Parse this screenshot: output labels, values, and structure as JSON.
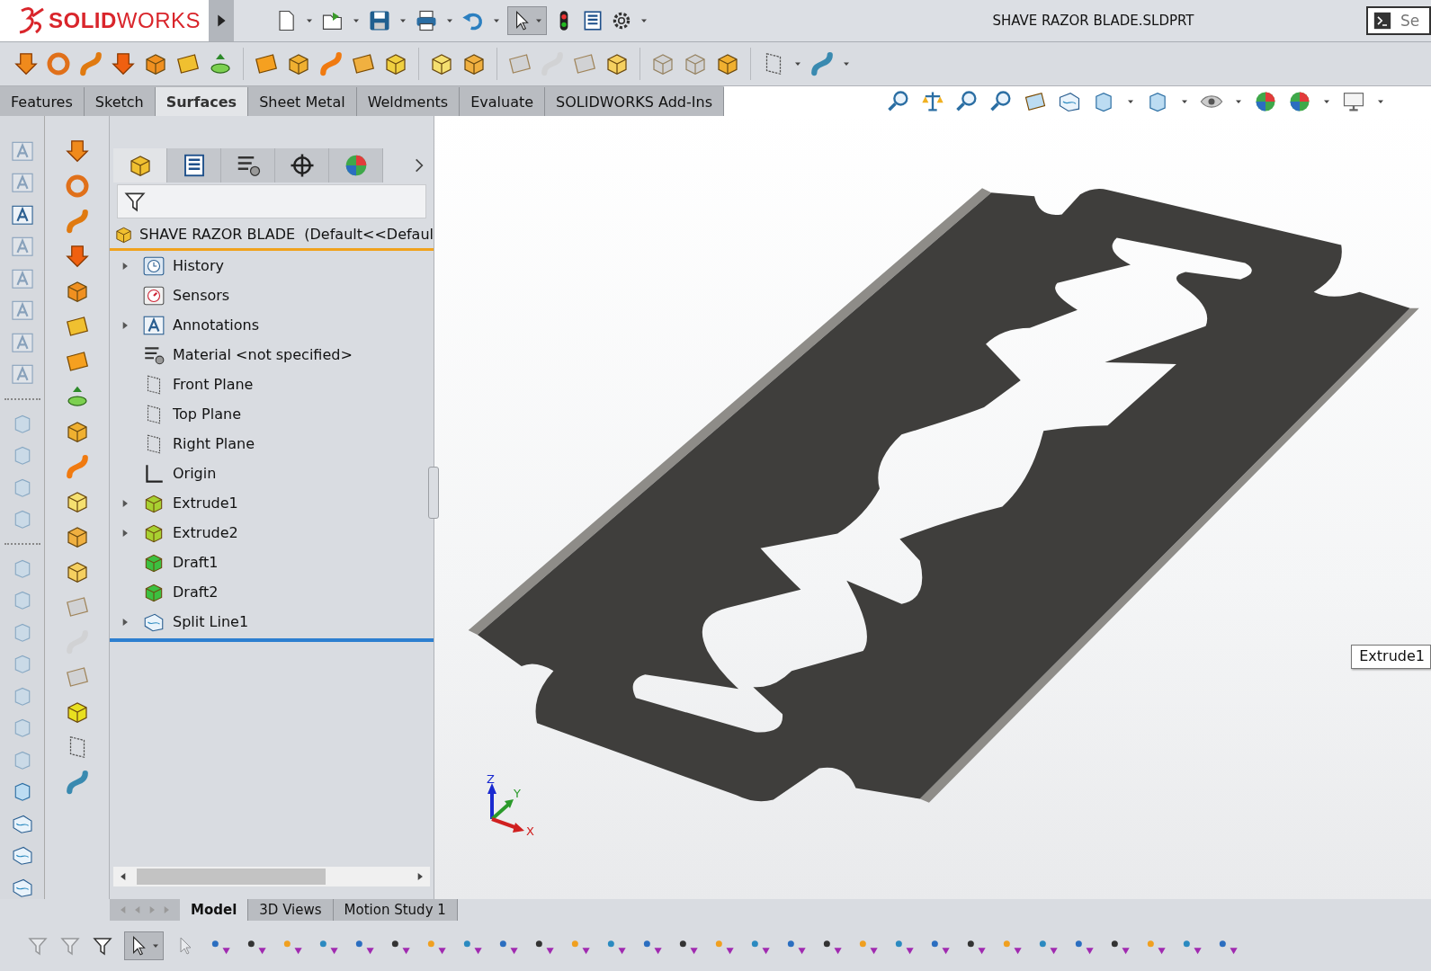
{
  "title_bar": {
    "logo": "**SOLID**WORKS",
    "document_title": "SHAVE RAZOR BLADE.SLDPRT",
    "search": {
      "placeholder": "Se"
    }
  },
  "command_tabs": [
    {
      "label": "Features",
      "selected": false
    },
    {
      "label": "Sketch",
      "selected": false
    },
    {
      "label": "Surfaces",
      "selected": true
    },
    {
      "label": "Sheet Metal",
      "selected": false
    },
    {
      "label": "Weldments",
      "selected": false
    },
    {
      "label": "Evaluate",
      "selected": false
    },
    {
      "label": "SOLIDWORKS Add-Ins",
      "selected": false
    }
  ],
  "feature_tree": {
    "root": {
      "label": "SHAVE RAZOR BLADE  (Default<<Defaul"
    },
    "items": [
      {
        "label": "History",
        "kind": "history",
        "expandable": true
      },
      {
        "label": "Sensors",
        "kind": "sensors",
        "expandable": false
      },
      {
        "label": "Annotations",
        "kind": "annotations",
        "expandable": true
      },
      {
        "label": "Material <not specified>",
        "kind": "material",
        "expandable": false
      },
      {
        "label": "Front Plane",
        "kind": "plane",
        "expandable": false
      },
      {
        "label": "Top Plane",
        "kind": "plane",
        "expandable": false
      },
      {
        "label": "Right Plane",
        "kind": "plane",
        "expandable": false
      },
      {
        "label": "Origin",
        "kind": "origin",
        "expandable": false
      },
      {
        "label": "Extrude1",
        "kind": "extrude",
        "expandable": true
      },
      {
        "label": "Extrude2",
        "kind": "extrude",
        "expandable": true
      },
      {
        "label": "Draft1",
        "kind": "draft",
        "expandable": false
      },
      {
        "label": "Draft2",
        "kind": "draft",
        "expandable": false
      },
      {
        "label": "Split Line1",
        "kind": "split",
        "expandable": true
      }
    ]
  },
  "viewport": {
    "tooltip": "Extrude1",
    "triad": [
      "Z",
      "Y",
      "X"
    ]
  },
  "bottom_tabs": [
    {
      "label": "Model",
      "selected": true
    },
    {
      "label": "3D Views",
      "selected": false
    },
    {
      "label": "Motion Study 1",
      "selected": false
    }
  ]
}
